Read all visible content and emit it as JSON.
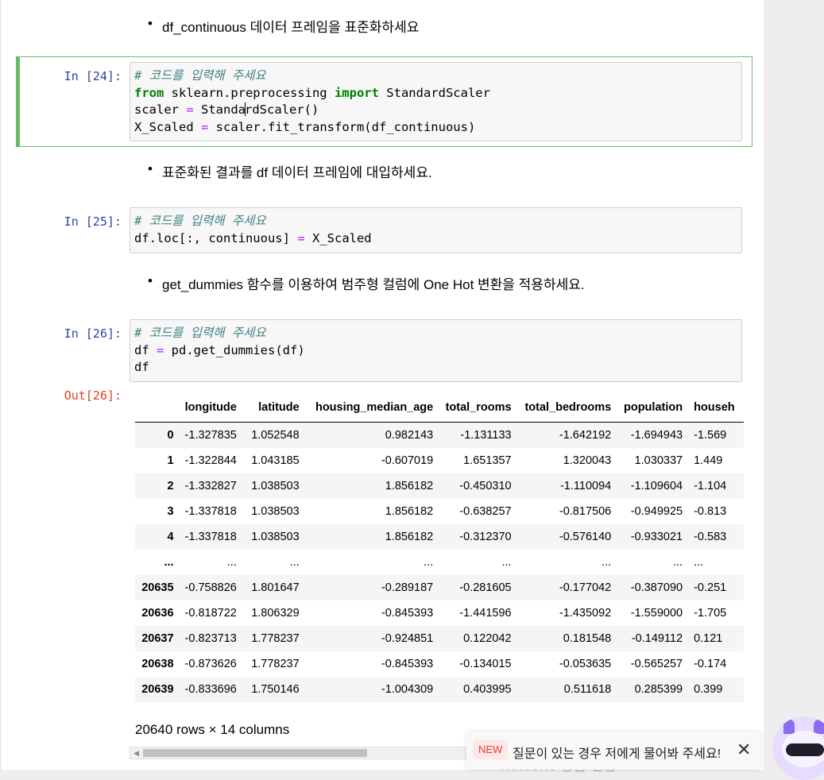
{
  "markdown": {
    "bullet1": "df_continuous 데이터 프레임을 표준화하세요",
    "bullet2": "표준화된 결과를 df 데이터 프레임에 대입하세요.",
    "bullet3": "get_dummies 함수를 이용하여 범주형 컬럼에 One Hot 변환을 적용하세요."
  },
  "cells": {
    "c24": {
      "prompt": "In [24]:",
      "comment": "# 코드를 입력해 주세요",
      "l2_kw1": "from",
      "l2_mid": " sklearn.preprocessing ",
      "l2_kw2": "import",
      "l2_end": " StandardScaler",
      "l3_a": "scaler ",
      "l3_op": "=",
      "l3_b": " Standa",
      "l3_c": "rdScaler()",
      "l4_a": "X_Scaled ",
      "l4_op": "=",
      "l4_b": " scaler.fit_transform(df_continuous)"
    },
    "c25": {
      "prompt": "In [25]:",
      "comment": "# 코드를 입력해 주세요",
      "l2_a": "df.loc[:, continuous] ",
      "l2_op": "=",
      "l2_b": " X_Scaled"
    },
    "c26": {
      "prompt": "In [26]:",
      "comment": "# 코드를 입력해 주세요",
      "l2_a": "df ",
      "l2_op": "=",
      "l2_b": " pd.get_dummies(df)",
      "l3": "df",
      "out_prompt": "Out[26]:"
    }
  },
  "dataframe": {
    "columns": [
      "longitude",
      "latitude",
      "housing_median_age",
      "total_rooms",
      "total_bedrooms",
      "population",
      "househ"
    ],
    "rows": [
      {
        "index": "0",
        "values": [
          "-1.327835",
          "1.052548",
          "0.982143",
          "-1.131133",
          "-1.642192",
          "-1.694943",
          "-1.569"
        ]
      },
      {
        "index": "1",
        "values": [
          "-1.322844",
          "1.043185",
          "-0.607019",
          "1.651357",
          "1.320043",
          "1.030337",
          "1.449"
        ]
      },
      {
        "index": "2",
        "values": [
          "-1.332827",
          "1.038503",
          "1.856182",
          "-0.450310",
          "-1.110094",
          "-1.109604",
          "-1.104"
        ]
      },
      {
        "index": "3",
        "values": [
          "-1.337818",
          "1.038503",
          "1.856182",
          "-0.638257",
          "-0.817506",
          "-0.949925",
          "-0.813"
        ]
      },
      {
        "index": "4",
        "values": [
          "-1.337818",
          "1.038503",
          "1.856182",
          "-0.312370",
          "-0.576140",
          "-0.933021",
          "-0.583"
        ]
      },
      {
        "index": "...",
        "values": [
          "...",
          "...",
          "...",
          "...",
          "...",
          "...",
          "..."
        ]
      },
      {
        "index": "20635",
        "values": [
          "-0.758826",
          "1.801647",
          "-0.289187",
          "-0.281605",
          "-0.177042",
          "-0.387090",
          "-0.251"
        ]
      },
      {
        "index": "20636",
        "values": [
          "-0.818722",
          "1.806329",
          "-0.845393",
          "-1.441596",
          "-1.435092",
          "-1.559000",
          "-1.705"
        ]
      },
      {
        "index": "20637",
        "values": [
          "-0.823713",
          "1.778237",
          "-0.924851",
          "0.122042",
          "0.181548",
          "-0.149112",
          "0.121"
        ]
      },
      {
        "index": "20638",
        "values": [
          "-0.873626",
          "1.778237",
          "-0.845393",
          "-0.134015",
          "-0.053635",
          "-0.565257",
          "-0.174"
        ]
      },
      {
        "index": "20639",
        "values": [
          "-0.833696",
          "1.750146",
          "-1.004309",
          "0.403995",
          "0.511618",
          "0.285399",
          "0.399"
        ]
      }
    ],
    "summary": "20640 rows × 14 columns"
  },
  "toast": {
    "badge": "NEW",
    "message": "질문이 있는 경우 저에게 물어봐 주세요!",
    "close": "✕"
  },
  "watermark": "Windows 정품 인증",
  "colors": {
    "selected_cell_border": "#66bb6a",
    "in_prompt": "#303f9f",
    "out_prompt": "#d84315",
    "keyword": "#008000",
    "comment": "#408080",
    "operator": "#aa22ff"
  }
}
